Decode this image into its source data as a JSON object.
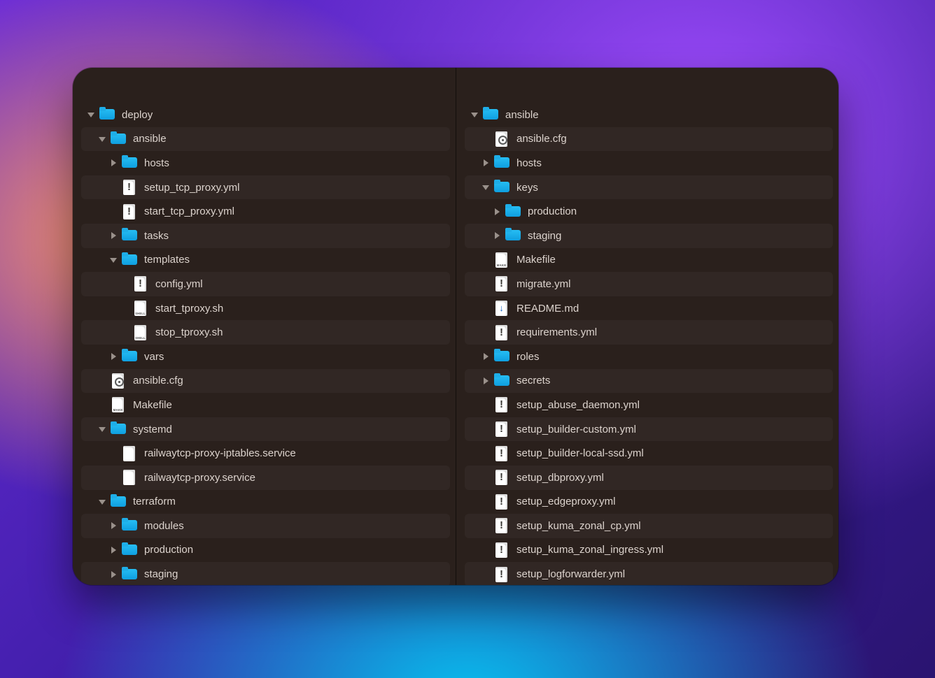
{
  "indentUnit": 16,
  "baseIndent": 8,
  "panes": {
    "left": [
      {
        "depth": 0,
        "type": "folder",
        "state": "open",
        "key": "deploy",
        "label": "deploy"
      },
      {
        "depth": 1,
        "type": "folder",
        "state": "open",
        "key": "ansible_l",
        "label": "ansible"
      },
      {
        "depth": 2,
        "type": "folder",
        "state": "closed",
        "key": "hosts_l",
        "label": "hosts"
      },
      {
        "depth": 2,
        "type": "file",
        "icon": "yml",
        "key": "setup_tcp_proxy",
        "label": "setup_tcp_proxy.yml"
      },
      {
        "depth": 2,
        "type": "file",
        "icon": "yml",
        "key": "start_tcp_proxy",
        "label": "start_tcp_proxy.yml"
      },
      {
        "depth": 2,
        "type": "folder",
        "state": "closed",
        "key": "tasks",
        "label": "tasks"
      },
      {
        "depth": 2,
        "type": "folder",
        "state": "open",
        "key": "templates",
        "label": "templates"
      },
      {
        "depth": 3,
        "type": "file",
        "icon": "yml",
        "key": "config_yml",
        "label": "config.yml"
      },
      {
        "depth": 3,
        "type": "file",
        "icon": "sh",
        "key": "start_tproxy_sh",
        "label": "start_tproxy.sh"
      },
      {
        "depth": 3,
        "type": "file",
        "icon": "sh",
        "key": "stop_tproxy_sh",
        "label": "stop_tproxy.sh"
      },
      {
        "depth": 2,
        "type": "folder",
        "state": "closed",
        "key": "vars",
        "label": "vars"
      },
      {
        "depth": 1,
        "type": "file",
        "icon": "cfg",
        "key": "ansible_cfg_l",
        "label": "ansible.cfg"
      },
      {
        "depth": 1,
        "type": "file",
        "icon": "make",
        "key": "makefile_l",
        "label": "Makefile"
      },
      {
        "depth": 1,
        "type": "folder",
        "state": "open",
        "key": "systemd",
        "label": "systemd"
      },
      {
        "depth": 2,
        "type": "file",
        "icon": "plain",
        "key": "svc_iptables",
        "label": "railwaytcp-proxy-iptables.service"
      },
      {
        "depth": 2,
        "type": "file",
        "icon": "plain",
        "key": "svc_proxy",
        "label": "railwaytcp-proxy.service"
      },
      {
        "depth": 1,
        "type": "folder",
        "state": "open",
        "key": "terraform",
        "label": "terraform"
      },
      {
        "depth": 2,
        "type": "folder",
        "state": "closed",
        "key": "modules",
        "label": "modules"
      },
      {
        "depth": 2,
        "type": "folder",
        "state": "closed",
        "key": "production_tf",
        "label": "production"
      },
      {
        "depth": 2,
        "type": "folder",
        "state": "closed",
        "key": "staging_tf",
        "label": "staging"
      }
    ],
    "right": [
      {
        "depth": 0,
        "type": "folder",
        "state": "open",
        "key": "ansible_r",
        "label": "ansible"
      },
      {
        "depth": 1,
        "type": "file",
        "icon": "cfg",
        "key": "ansible_cfg_r",
        "label": "ansible.cfg"
      },
      {
        "depth": 1,
        "type": "folder",
        "state": "closed",
        "key": "hosts_r",
        "label": "hosts"
      },
      {
        "depth": 1,
        "type": "folder",
        "state": "open",
        "key": "keys",
        "label": "keys"
      },
      {
        "depth": 2,
        "type": "folder",
        "state": "closed",
        "key": "production_keys",
        "label": "production"
      },
      {
        "depth": 2,
        "type": "folder",
        "state": "closed",
        "key": "staging_keys",
        "label": "staging"
      },
      {
        "depth": 1,
        "type": "file",
        "icon": "make",
        "key": "makefile_r",
        "label": "Makefile"
      },
      {
        "depth": 1,
        "type": "file",
        "icon": "yml",
        "key": "migrate_yml",
        "label": "migrate.yml"
      },
      {
        "depth": 1,
        "type": "file",
        "icon": "md",
        "key": "readme_md",
        "label": "README.md"
      },
      {
        "depth": 1,
        "type": "file",
        "icon": "yml",
        "key": "requirements_yml",
        "label": "requirements.yml"
      },
      {
        "depth": 1,
        "type": "folder",
        "state": "closed",
        "key": "roles",
        "label": "roles"
      },
      {
        "depth": 1,
        "type": "folder",
        "state": "closed",
        "key": "secrets",
        "label": "secrets"
      },
      {
        "depth": 1,
        "type": "file",
        "icon": "yml",
        "key": "setup_abuse_daemon",
        "label": "setup_abuse_daemon.yml"
      },
      {
        "depth": 1,
        "type": "file",
        "icon": "yml",
        "key": "setup_builder_custom",
        "label": "setup_builder-custom.yml"
      },
      {
        "depth": 1,
        "type": "file",
        "icon": "yml",
        "key": "setup_builder_local",
        "label": "setup_builder-local-ssd.yml"
      },
      {
        "depth": 1,
        "type": "file",
        "icon": "yml",
        "key": "setup_dbproxy",
        "label": "setup_dbproxy.yml"
      },
      {
        "depth": 1,
        "type": "file",
        "icon": "yml",
        "key": "setup_edgeproxy",
        "label": "setup_edgeproxy.yml"
      },
      {
        "depth": 1,
        "type": "file",
        "icon": "yml",
        "key": "setup_kuma_cp",
        "label": "setup_kuma_zonal_cp.yml"
      },
      {
        "depth": 1,
        "type": "file",
        "icon": "yml",
        "key": "setup_kuma_ingress",
        "label": "setup_kuma_zonal_ingress.yml"
      },
      {
        "depth": 1,
        "type": "file",
        "icon": "yml",
        "key": "setup_logforwarder",
        "label": "setup_logforwarder.yml"
      }
    ]
  }
}
